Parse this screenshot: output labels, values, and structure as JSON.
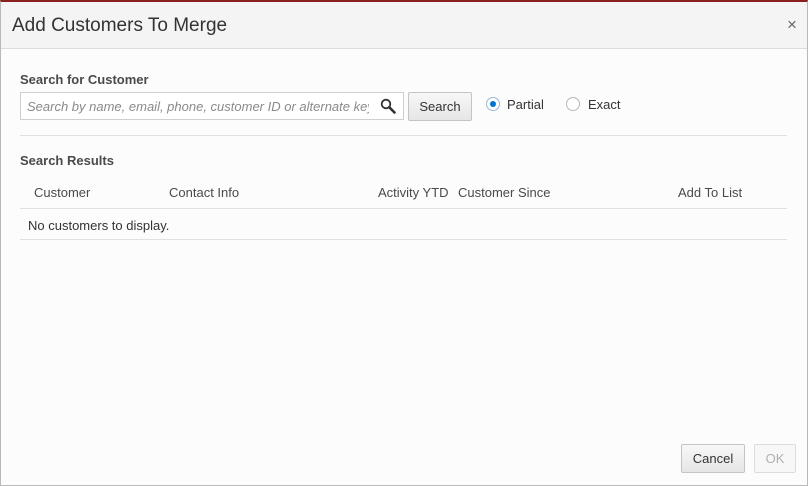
{
  "dialog": {
    "title": "Add Customers To Merge",
    "close_glyph": "×"
  },
  "search": {
    "section_label": "Search for Customer",
    "placeholder": "Search by name, email, phone, customer ID or alternate key",
    "value": "",
    "icon": "search-icon",
    "button_label": "Search",
    "match_options": [
      {
        "label": "Partial",
        "selected": true
      },
      {
        "label": "Exact",
        "selected": false
      }
    ]
  },
  "results": {
    "section_label": "Search Results",
    "columns": [
      "Customer",
      "Contact Info",
      "Activity YTD",
      "Customer Since",
      "Add To List"
    ],
    "empty_message": "No customers to display."
  },
  "footer": {
    "cancel_label": "Cancel",
    "ok_label": "OK",
    "ok_enabled": false
  },
  "colors": {
    "accent": "#0572ce",
    "top_border": "#8b2020"
  }
}
